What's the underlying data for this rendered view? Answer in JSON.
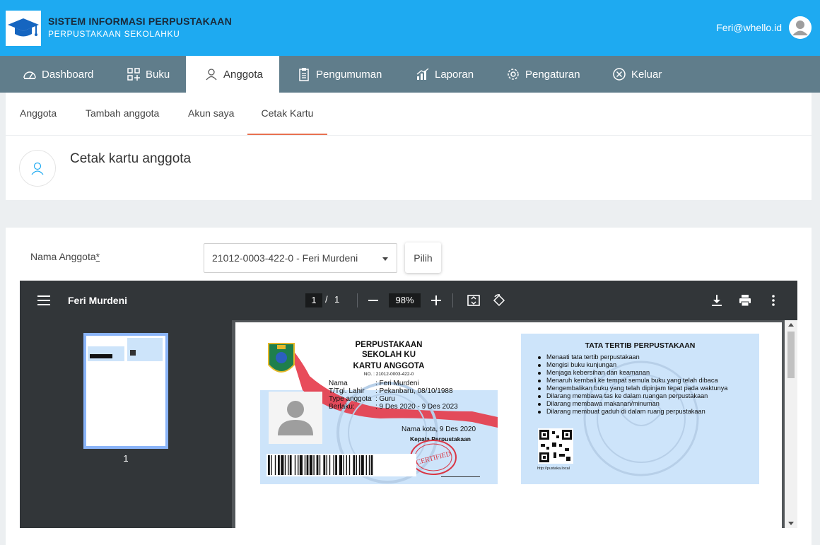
{
  "header": {
    "title": "SISTEM INFORMASI PERPUSTAKAAN",
    "subtitle": "PERPUSTAKAAN SEKOLAHKU",
    "user_email": "Feri@whello.id",
    "logo_icon": "graduation-cap-icon",
    "bg_color": "#1eaaf1"
  },
  "nav": {
    "items": [
      {
        "label": "Dashboard",
        "icon": "dashboard-icon"
      },
      {
        "label": "Buku",
        "icon": "grid-plus-icon"
      },
      {
        "label": "Anggota",
        "icon": "user-icon"
      },
      {
        "label": "Pengumuman",
        "icon": "clipboard-icon"
      },
      {
        "label": "Laporan",
        "icon": "bar-chart-icon"
      },
      {
        "label": "Pengaturan",
        "icon": "gear-icon"
      },
      {
        "label": "Keluar",
        "icon": "close-circle-icon"
      }
    ],
    "active": "Anggota",
    "bg_color": "#607d8b"
  },
  "subnav": {
    "items": [
      {
        "label": "Anggota"
      },
      {
        "label": "Tambah anggota"
      },
      {
        "label": "Akun saya"
      },
      {
        "label": "Cetak Kartu"
      }
    ],
    "active": "Cetak Kartu",
    "accent_color": "#e8704f"
  },
  "page": {
    "title": "Cetak kartu anggota"
  },
  "form": {
    "label": "Nama Anggota",
    "required_mark": "*",
    "selected_member": "21012-0003-422-0 - Feri Murdeni",
    "button_label": "Pilih"
  },
  "pdf_viewer": {
    "title": "Feri Murdeni",
    "current_page": "1",
    "page_separator": "/",
    "total_pages": "1",
    "zoom": "98%",
    "thumbnail_label": "1"
  },
  "card_front": {
    "library_line1": "PERPUSTAKAAN",
    "library_line2": "SEKOLAH KU",
    "card_title": "KARTU ANGGOTA",
    "number": "NO. : 21012-0003-422-0",
    "fields": [
      {
        "key": "Nama",
        "value": ": Feri Murdeni"
      },
      {
        "key": "T/Tgl. Lahir",
        "value": ": Pekanbaru, 08/10/1988"
      },
      {
        "key": "Type anggota",
        "value": ": Guru"
      },
      {
        "key": "Berlaku:",
        "value": ": 9 Des 2020 - 9 Des 2023"
      }
    ],
    "place_date": "Nama kota, 9 Des 2020",
    "signer": "Kepala Perpustakaan",
    "stamp": "CERTIFIED"
  },
  "card_back": {
    "title": "TATA TERTIB PERPUSTAKAAN",
    "rules": [
      "Menaati tata tertib perpustakaan",
      "Mengisi buku kunjungan",
      "Menjaga kebersihan dan keamanan",
      "Menaruh kembali ke tempat semula buku yang telah dibaca",
      "Mengembalikan buku yang telah dipinjam tepat pada waktunya",
      "Dilarang membawa tas ke dalam ruangan perpustakaan",
      "Dilarang membawa makanan/minuman",
      "Dilarang membuat gaduh di dalam ruang perpustakaan"
    ],
    "url": "http://pustaka.local"
  }
}
